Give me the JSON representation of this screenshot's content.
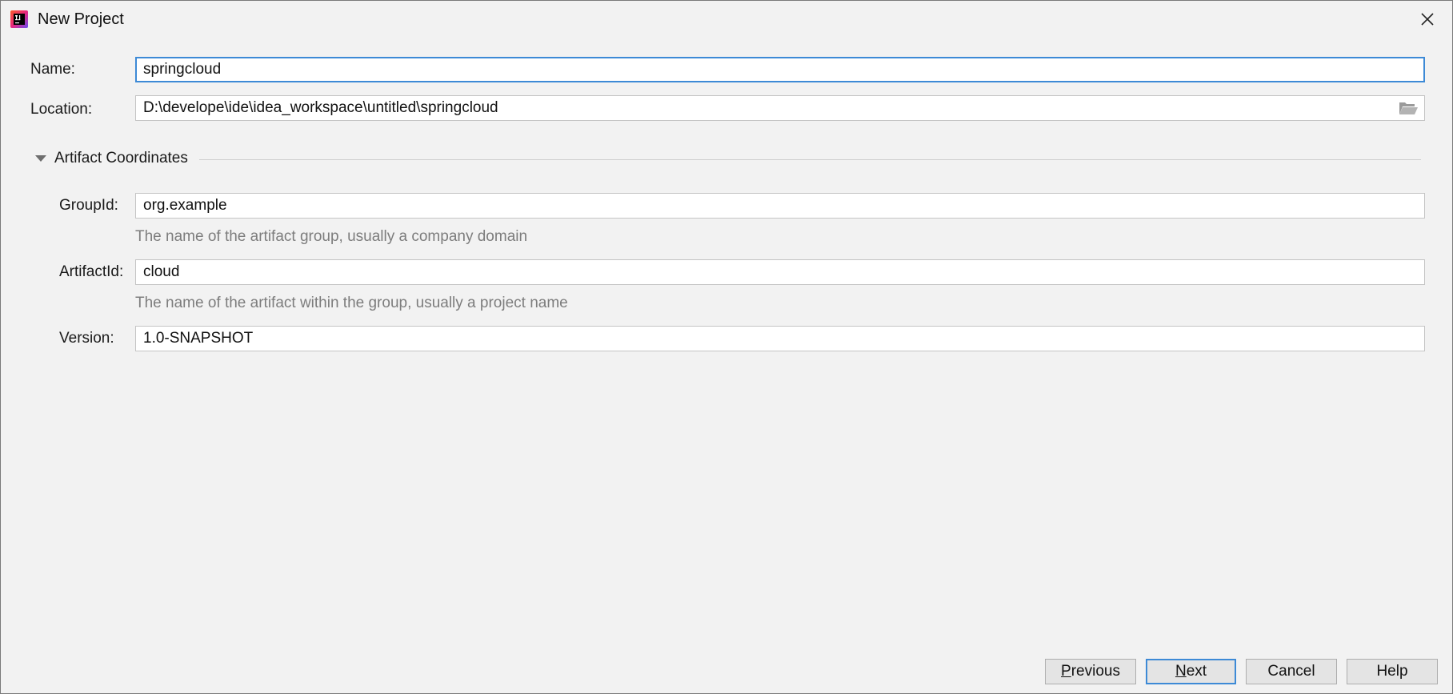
{
  "window": {
    "title": "New Project"
  },
  "form": {
    "name": {
      "label": "Name:",
      "value": "springcloud"
    },
    "location": {
      "label": "Location:",
      "value": "D:\\develope\\ide\\idea_workspace\\untitled\\springcloud"
    }
  },
  "artifact": {
    "title": "Artifact Coordinates",
    "group_id": {
      "label": "GroupId:",
      "value": "org.example",
      "hint": "The name of the artifact group, usually a company domain"
    },
    "artifact_id": {
      "label": "ArtifactId:",
      "value": "cloud",
      "hint": "The name of the artifact within the group, usually a project name"
    },
    "version": {
      "label": "Version:",
      "value": "1.0-SNAPSHOT"
    }
  },
  "buttons": {
    "previous": {
      "mnemonic": "P",
      "rest": "revious"
    },
    "next": {
      "mnemonic": "N",
      "rest": "ext"
    },
    "cancel": "Cancel",
    "help": "Help"
  },
  "colors": {
    "focus_border": "#3d8ad6",
    "background": "#f2f2f2",
    "hint_text": "#7d7d7d"
  },
  "icons": {
    "app": "intellij-idea-icon",
    "close": "close-icon",
    "browse": "folder-open-icon",
    "toggle": "triangle-down-icon"
  }
}
